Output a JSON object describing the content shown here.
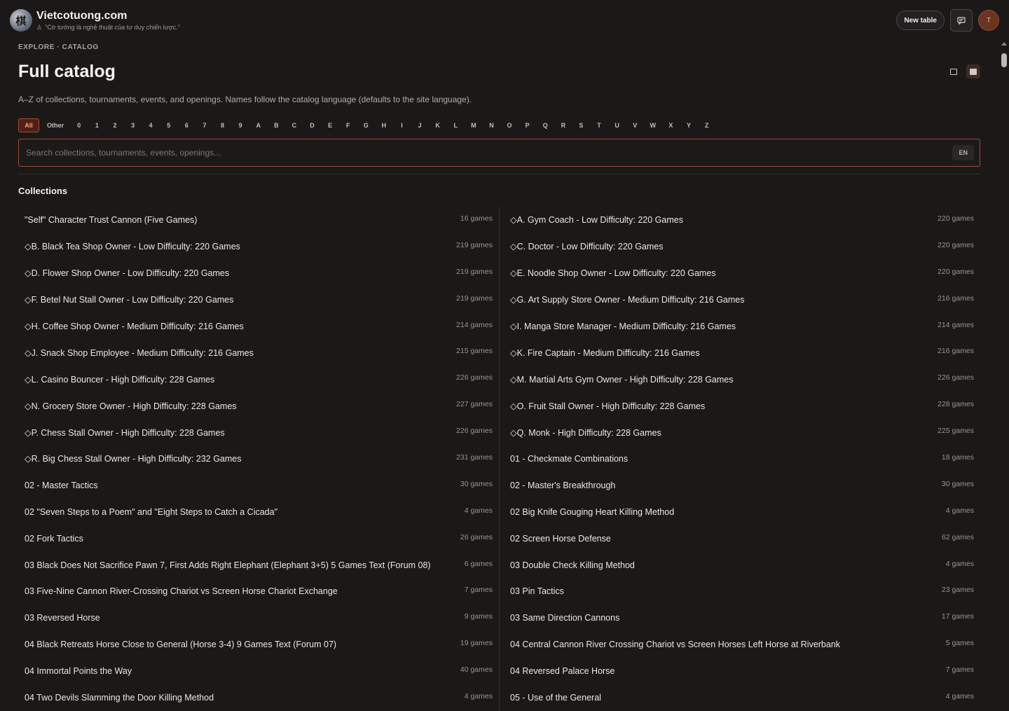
{
  "header": {
    "logo_glyph": "棋",
    "brand": "Vietcotuong.com",
    "tagline": "\"Cờ tướng là nghệ thuật của tư duy chiến lược.\"",
    "new_table": "New table",
    "chat_icon": "chat-icon",
    "avatar_initial": "T"
  },
  "breadcrumb": "EXPLORE · CATALOG",
  "page_title": "Full catalog",
  "subtitle": "A–Z of collections, tournaments, events, and openings. Names follow the catalog language (defaults to the site language).",
  "letters": [
    "All",
    "Other",
    "0",
    "1",
    "2",
    "3",
    "4",
    "5",
    "6",
    "7",
    "8",
    "9",
    "A",
    "B",
    "C",
    "D",
    "E",
    "F",
    "G",
    "H",
    "I",
    "J",
    "K",
    "L",
    "M",
    "N",
    "O",
    "P",
    "Q",
    "R",
    "S",
    "T",
    "U",
    "V",
    "W",
    "X",
    "Y",
    "Z"
  ],
  "search": {
    "placeholder": "Search collections, tournaments, events, openings...",
    "lang": "EN"
  },
  "section_title": "Collections",
  "colors": {
    "accent": "#b6452c",
    "background": "#1b1918"
  },
  "collections_left": [
    {
      "name": "\"Self\" Character Trust Cannon (Five Games)",
      "count": "16 games"
    },
    {
      "name": "◇B. Black Tea Shop Owner - Low Difficulty: 220 Games",
      "count": "219 games"
    },
    {
      "name": "◇D. Flower Shop Owner - Low Difficulty: 220 Games",
      "count": "219 games"
    },
    {
      "name": "◇F. Betel Nut Stall Owner - Low Difficulty: 220 Games",
      "count": "219 games"
    },
    {
      "name": "◇H. Coffee Shop Owner - Medium Difficulty: 216 Games",
      "count": "214 games"
    },
    {
      "name": "◇J. Snack Shop Employee - Medium Difficulty: 216 Games",
      "count": "215 games"
    },
    {
      "name": "◇L. Casino Bouncer - High Difficulty: 228 Games",
      "count": "226 games"
    },
    {
      "name": "◇N. Grocery Store Owner - High Difficulty: 228 Games",
      "count": "227 games"
    },
    {
      "name": "◇P. Chess Stall Owner - High Difficulty: 228 Games",
      "count": "226 games"
    },
    {
      "name": "◇R. Big Chess Stall Owner - High Difficulty: 232 Games",
      "count": "231 games"
    },
    {
      "name": "02 - Master Tactics",
      "count": "30 games"
    },
    {
      "name": "02 \"Seven Steps to a Poem\" and \"Eight Steps to Catch a Cicada\"",
      "count": "4 games"
    },
    {
      "name": "02 Fork Tactics",
      "count": "26 games"
    },
    {
      "name": "03 Black Does Not Sacrifice Pawn 7, First Adds Right Elephant (Elephant 3+5) 5 Games Text (Forum 08)",
      "count": "6 games"
    },
    {
      "name": "03 Five-Nine Cannon River-Crossing Chariot vs Screen Horse Chariot Exchange",
      "count": "7 games"
    },
    {
      "name": "03 Reversed Horse",
      "count": "9 games"
    },
    {
      "name": "04 Black Retreats Horse Close to General (Horse 3-4) 9 Games Text (Forum 07)",
      "count": "19 games"
    },
    {
      "name": "04 Immortal Points the Way",
      "count": "40 games"
    },
    {
      "name": "04 Two Devils Slamming the Door Killing Method",
      "count": "4 games"
    }
  ],
  "collections_right": [
    {
      "name": "◇A. Gym Coach - Low Difficulty: 220 Games",
      "count": "220 games"
    },
    {
      "name": "◇C. Doctor - Low Difficulty: 220 Games",
      "count": "220 games"
    },
    {
      "name": "◇E. Noodle Shop Owner - Low Difficulty: 220 Games",
      "count": "220 games"
    },
    {
      "name": "◇G. Art Supply Store Owner - Medium Difficulty: 216 Games",
      "count": "216 games"
    },
    {
      "name": "◇I. Manga Store Manager - Medium Difficulty: 216 Games",
      "count": "214 games"
    },
    {
      "name": "◇K. Fire Captain - Medium Difficulty: 216 Games",
      "count": "216 games"
    },
    {
      "name": "◇M. Martial Arts Gym Owner - High Difficulty: 228 Games",
      "count": "226 games"
    },
    {
      "name": "◇O. Fruit Stall Owner - High Difficulty: 228 Games",
      "count": "228 games"
    },
    {
      "name": "◇Q. Monk - High Difficulty: 228 Games",
      "count": "225 games"
    },
    {
      "name": "01 - Checkmate Combinations",
      "count": "18 games"
    },
    {
      "name": "02 - Master's Breakthrough",
      "count": "30 games"
    },
    {
      "name": "02 Big Knife Gouging Heart Killing Method",
      "count": "4 games"
    },
    {
      "name": "02 Screen Horse Defense",
      "count": "62 games"
    },
    {
      "name": "03 Double Check Killing Method",
      "count": "4 games"
    },
    {
      "name": "03 Pin Tactics",
      "count": "23 games"
    },
    {
      "name": "03 Same Direction Cannons",
      "count": "17 games"
    },
    {
      "name": "04 Central Cannon River Crossing Chariot vs Screen Horses Left Horse at Riverbank",
      "count": "5 games"
    },
    {
      "name": "04 Reversed Palace Horse",
      "count": "7 games"
    },
    {
      "name": "05 - Use of the General",
      "count": "4 games"
    }
  ]
}
